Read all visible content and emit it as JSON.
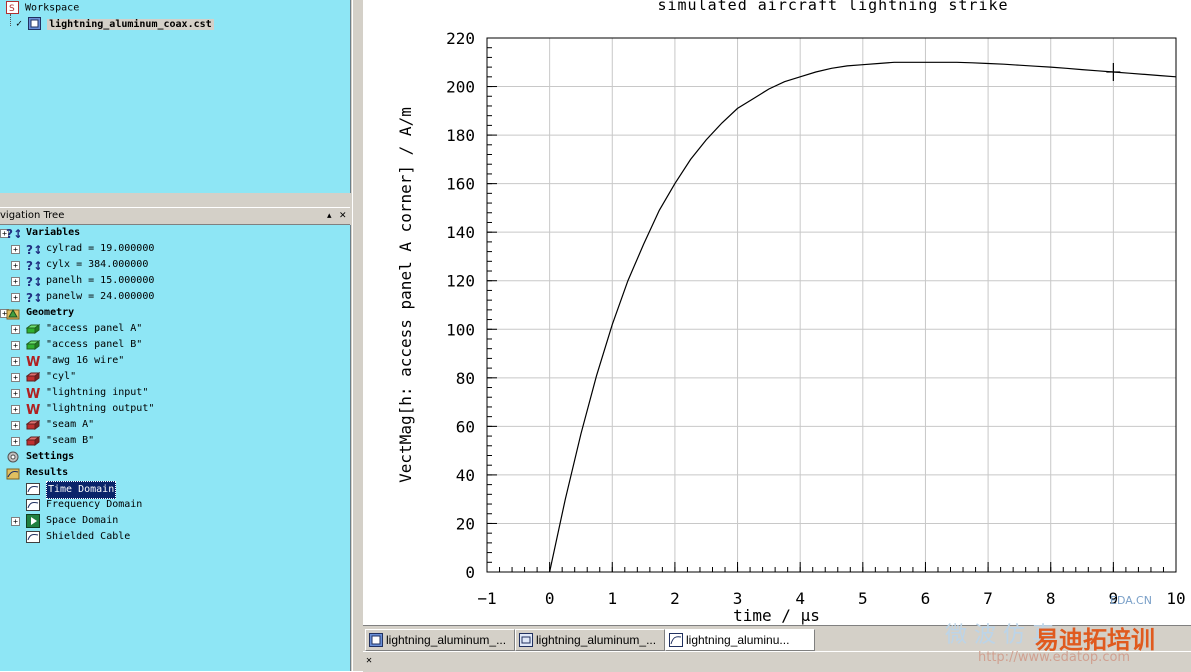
{
  "workspace": {
    "title": "Workspace",
    "project": "lightning_aluminum_coax.cst"
  },
  "nav_tree": {
    "title": "vigation Tree",
    "pin": "▴",
    "close": "✕",
    "groups": {
      "variables": "Variables",
      "geometry": "Geometry",
      "settings": "Settings",
      "results": "Results"
    },
    "variables": [
      "cylrad = 19.000000",
      "cylx = 384.000000",
      "panelh = 15.000000",
      "panelw = 24.000000"
    ],
    "geometry": [
      "\"access panel A\"",
      "\"access panel B\"",
      "\"awg 16 wire\"",
      "\"cyl\"",
      "\"lightning input\"",
      "\"lightning output\"",
      "\"seam A\"",
      "\"seam B\""
    ],
    "results": [
      "Time Domain",
      "Frequency Domain",
      "Space Domain",
      "Shielded Cable"
    ]
  },
  "tabs": [
    "lightning_aluminum_...",
    "lightning_aluminum_...",
    "lightning_aluminu..."
  ],
  "watermark": {
    "site": "EDA.CN",
    "brand_cn": "易迪拓培训",
    "url": "http://www.edatop.com",
    "mw": "微 波 仿 真"
  },
  "chart_data": {
    "type": "line",
    "title": "simulated aircraft lightning strike",
    "xlabel": "time / µs",
    "ylabel": "VectMag[h: access panel A corner] / A/m",
    "xlim": [
      -1,
      10
    ],
    "ylim": [
      0,
      220
    ],
    "xticks": [
      -1,
      0,
      1,
      2,
      3,
      4,
      5,
      6,
      7,
      8,
      9,
      10
    ],
    "yticks": [
      0,
      20,
      40,
      60,
      80,
      100,
      120,
      140,
      160,
      180,
      200,
      220
    ],
    "grid": true,
    "marker_x": 9,
    "series": [
      {
        "x": [
          0,
          0.25,
          0.5,
          0.75,
          1,
          1.25,
          1.5,
          1.75,
          2,
          2.25,
          2.5,
          2.75,
          3,
          3.25,
          3.5,
          3.75,
          4,
          4.25,
          4.5,
          4.75,
          5,
          5.25,
          5.5,
          5.75,
          6,
          6.25,
          6.5,
          6.75,
          7,
          7.25,
          7.5,
          7.75,
          8,
          8.25,
          8.5,
          8.75,
          9,
          9.25,
          9.5,
          9.75,
          10
        ],
        "y": [
          0,
          30,
          57,
          81,
          102,
          120,
          135,
          149,
          160,
          170,
          178,
          185,
          191,
          195,
          199,
          202,
          204,
          206,
          207.5,
          208.5,
          209,
          209.5,
          210,
          210,
          210,
          210,
          210,
          209.8,
          209.5,
          209.2,
          208.8,
          208.4,
          208,
          207.5,
          207,
          206.5,
          206,
          205.5,
          205,
          204.5,
          204
        ]
      }
    ]
  }
}
